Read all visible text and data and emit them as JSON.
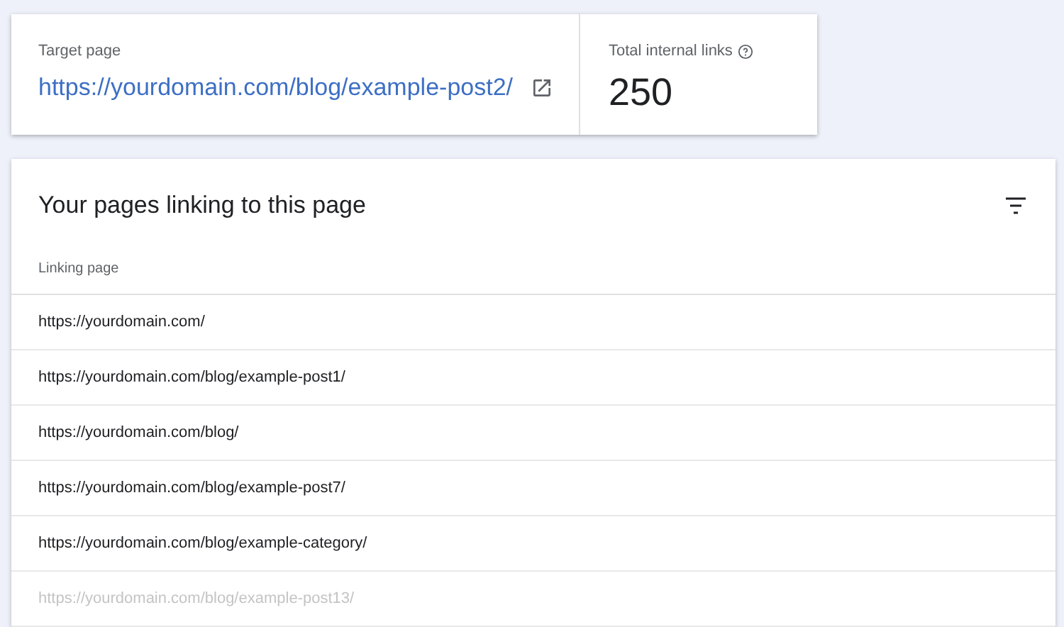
{
  "summary": {
    "target_label": "Target page",
    "target_url": "https://yourdomain.com/blog/example-post2/",
    "total_label": "Total internal links",
    "total_value": "250"
  },
  "table": {
    "title": "Your pages linking to this page",
    "columns": [
      "Linking page"
    ],
    "rows": [
      {
        "url": "https://yourdomain.com/",
        "faded": false
      },
      {
        "url": "https://yourdomain.com/blog/example-post1/",
        "faded": false
      },
      {
        "url": "https://yourdomain.com/blog/",
        "faded": false
      },
      {
        "url": "https://yourdomain.com/blog/example-post7/",
        "faded": false
      },
      {
        "url": "https://yourdomain.com/blog/example-category/",
        "faded": false
      },
      {
        "url": "https://yourdomain.com/blog/example-post13/",
        "faded": true
      }
    ]
  }
}
